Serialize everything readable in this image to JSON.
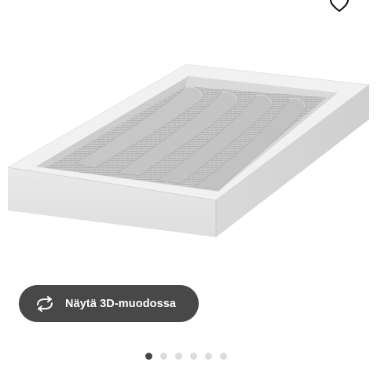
{
  "product": {
    "image_name": "storage-tray-with-grey-felt-insert",
    "tray_color": "#e6e6e6",
    "felt_color": "#bdbdbd"
  },
  "actions": {
    "favorite_icon": "heart-icon",
    "view_3d_label": "Näytä 3D-muodossa",
    "view_3d_icon": "rotate-3d-icon",
    "button_color": "#484848"
  },
  "carousel": {
    "total_images": 6,
    "active_index": 0
  }
}
